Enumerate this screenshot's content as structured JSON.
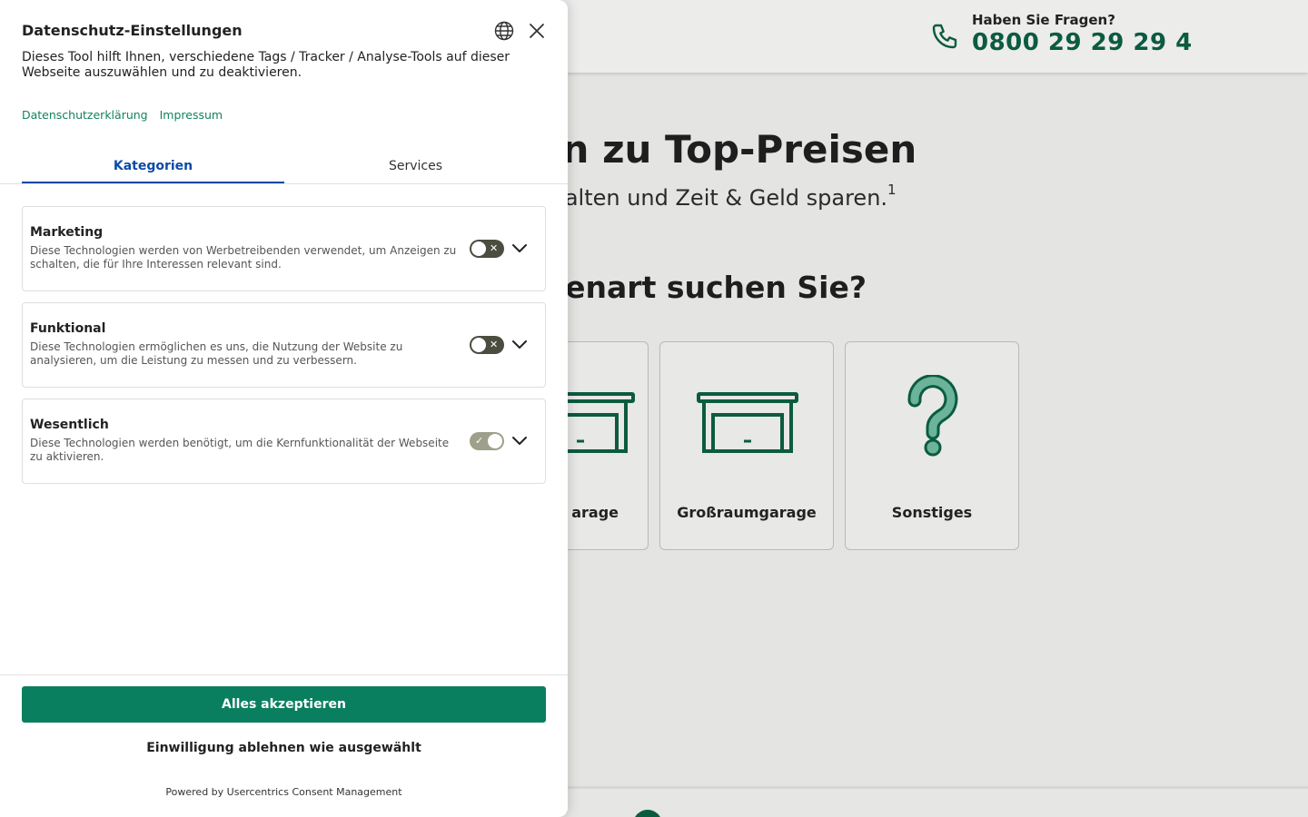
{
  "background": {
    "header": {
      "question": "Haben Sie Fragen?",
      "phone": "0800 29 29 29 4"
    },
    "hero_title": "gen zu Top-Preisen",
    "hero_subtitle": "e erhalten und Zeit & Geld sparen.",
    "hero_footnote": "1",
    "question_title": "ragenart suchen Sie?",
    "cards": [
      {
        "label": "arage",
        "icon": "garage-icon"
      },
      {
        "label": "Großraumgarage",
        "icon": "large-garage-icon"
      },
      {
        "label": "Sonstiges",
        "icon": "question-mark-icon"
      }
    ],
    "brand_color": "#0b5b40"
  },
  "consent": {
    "title": "Datenschutz-Einstellungen",
    "description": "Dieses Tool hilft Ihnen, verschiedene Tags / Tracker / Analyse-Tools auf dieser Webseite auszuwählen und zu deaktivieren.",
    "links": [
      "Datenschutzerklärung",
      "Impressum"
    ],
    "tabs": [
      {
        "label": "Kategorien",
        "active": true
      },
      {
        "label": "Services",
        "active": false
      }
    ],
    "categories": [
      {
        "title": "Marketing",
        "description": "Diese Technologien werden von Werbetreibenden verwendet, um Anzeigen zu schalten, die für Ihre Interessen relevant sind.",
        "enabled": false
      },
      {
        "title": "Funktional",
        "description": "Diese Technologien ermöglichen es uns, die Nutzung der Website zu analysieren, um die Leistung zu messen und zu verbessern.",
        "enabled": false
      },
      {
        "title": "Wesentlich",
        "description": "Diese Technologien werden benötigt, um die Kernfunktionalität der Webseite zu aktivieren.",
        "enabled": true
      }
    ],
    "accept_label": "Alles akzeptieren",
    "deny_label": "Einwilligung ablehnen wie ausgewählt",
    "powered_by": "Powered by Usercentrics Consent Management",
    "accent_color": "#0a7f5f",
    "tab_active_color": "#0c4aa6"
  }
}
